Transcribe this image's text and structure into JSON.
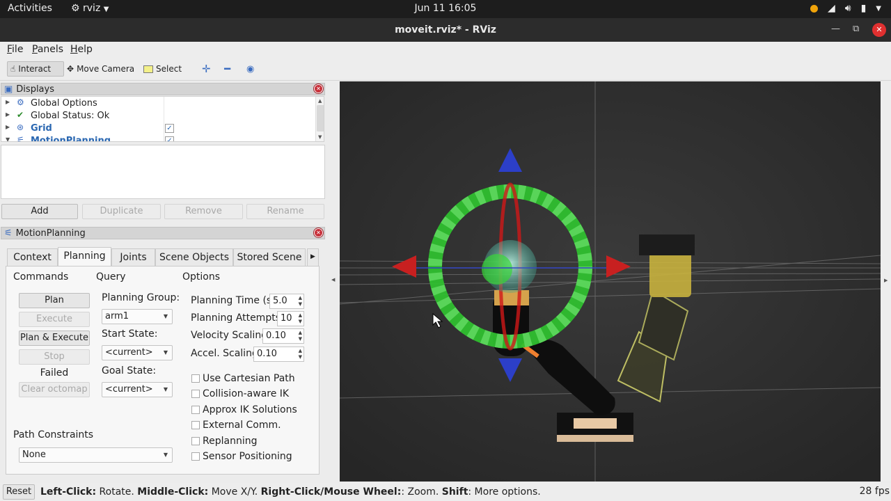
{
  "gnome": {
    "activities": "Activities",
    "app_name": "rviz",
    "clock": "Jun 11  16:05"
  },
  "window": {
    "title": "moveit.rviz* - RViz"
  },
  "menu": {
    "file": "File",
    "panels": "Panels",
    "help": "Help"
  },
  "toolbar": {
    "interact": "Interact",
    "move_camera": "Move Camera",
    "select": "Select"
  },
  "displays": {
    "title": "Displays",
    "items": [
      {
        "label": "Global Options",
        "icon": "gear-icon"
      },
      {
        "label": "Global Status: Ok",
        "icon": "check-icon"
      },
      {
        "label": "Grid",
        "icon": "grid-icon",
        "checked": true
      },
      {
        "label": "MotionPlanning",
        "icon": "motion-icon",
        "checked": true
      }
    ],
    "buttons": {
      "add": "Add",
      "duplicate": "Duplicate",
      "remove": "Remove",
      "rename": "Rename"
    }
  },
  "motion_planning": {
    "title": "MotionPlanning",
    "tabs": [
      "Context",
      "Planning",
      "Joints",
      "Scene Objects",
      "Stored Scene"
    ],
    "active_tab": "Planning",
    "commands": {
      "header": "Commands",
      "plan": "Plan",
      "execute": "Execute",
      "plan_execute": "Plan & Execute",
      "stop": "Stop",
      "status": "Failed",
      "clear_octomap": "Clear octomap"
    },
    "query": {
      "header": "Query",
      "planning_group_label": "Planning Group:",
      "planning_group": "arm1",
      "start_state_label": "Start State:",
      "start_state": "<current>",
      "goal_state_label": "Goal State:",
      "goal_state": "<current>"
    },
    "options": {
      "header": "Options",
      "planning_time_label": "Planning Time (s):",
      "planning_time": "5.0",
      "planning_attempts_label": "Planning Attempts:",
      "planning_attempts": "10",
      "velocity_label": "Velocity Scaling:",
      "velocity": "0.10",
      "accel_label": "Accel. Scaling:",
      "accel": "0.10",
      "checkboxes": [
        "Use Cartesian Path",
        "Collision-aware IK",
        "Approx IK Solutions",
        "External Comm.",
        "Replanning",
        "Sensor Positioning"
      ]
    },
    "path_constraints": {
      "label": "Path Constraints",
      "value": "None"
    }
  },
  "status_bar": {
    "reset": "Reset",
    "left_click": "Left-Click:",
    "left_desc": " Rotate. ",
    "middle_click": "Middle-Click:",
    "middle_desc": " Move X/Y. ",
    "right_click": "Right-Click/Mouse Wheel:",
    "right_desc": ": Zoom. ",
    "shift": "Shift",
    "shift_desc": ": More options.",
    "fps": "28 fps"
  }
}
